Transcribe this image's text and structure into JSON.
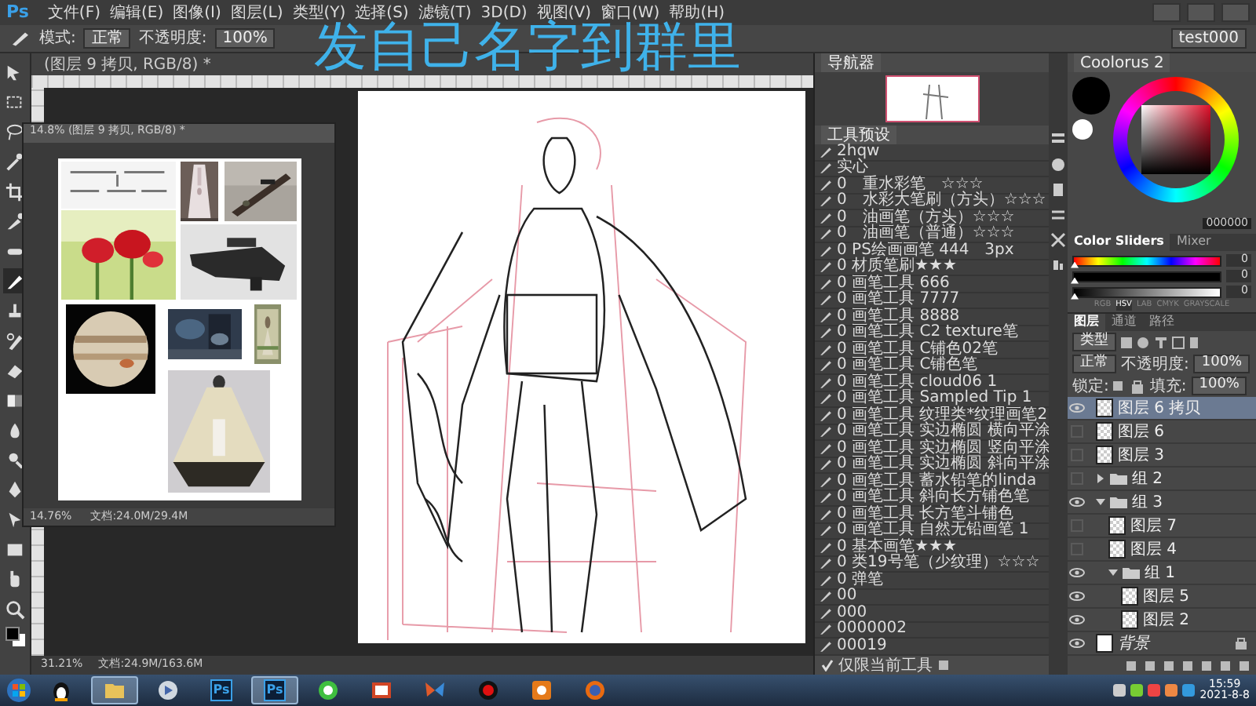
{
  "app_logo": "Ps",
  "menu": [
    "文件(F)",
    "编辑(E)",
    "图像(I)",
    "图层(L)",
    "类型(Y)",
    "选择(S)",
    "滤镜(T)",
    "3D(D)",
    "视图(V)",
    "窗口(W)",
    "帮助(H)"
  ],
  "options": {
    "mode_label": "模式:",
    "mode": "正常",
    "opacity_label": "不透明度:",
    "opacity": "100%",
    "workspace": "test000"
  },
  "caption": "发自己名字到群里",
  "toolbar": [
    {
      "kind": "move",
      "selected": false
    },
    {
      "kind": "marquee",
      "selected": false
    },
    {
      "kind": "lasso",
      "selected": false
    },
    {
      "kind": "wand",
      "selected": false
    },
    {
      "kind": "crop",
      "selected": false
    },
    {
      "kind": "eyedropper",
      "selected": false
    },
    {
      "kind": "heal",
      "selected": false
    },
    {
      "kind": "brush",
      "selected": true
    },
    {
      "kind": "stamp",
      "selected": false
    },
    {
      "kind": "history",
      "selected": false
    },
    {
      "kind": "eraser",
      "selected": false
    },
    {
      "kind": "gradient",
      "selected": false
    },
    {
      "kind": "blur",
      "selected": false
    },
    {
      "kind": "dodge",
      "selected": false
    },
    {
      "kind": "pen",
      "selected": false
    },
    {
      "kind": "path",
      "selected": false
    },
    {
      "kind": "shape",
      "selected": false
    },
    {
      "kind": "hand",
      "selected": false
    },
    {
      "kind": "zoom",
      "selected": false
    }
  ],
  "document": {
    "tab": "(图层 9 拷贝, RGB/8) *",
    "zoom": "31.21%",
    "info": "文档:24.9M/163.6M"
  },
  "reference_window": {
    "title": "14.8% (图层 9 拷贝, RGB/8) *",
    "zoom": "14.76%",
    "info": "文档:24.0M/29.4M"
  },
  "navigator": {
    "title": "导航器"
  },
  "tool_presets": {
    "title": "工具预设",
    "items": [
      "2hqw",
      "实心",
      "0　重水彩笔　☆☆☆",
      "0　水彩大笔刷（方头）☆☆☆",
      "0　油画笔（方头）☆☆☆",
      "0　油画笔（普通）☆☆☆",
      "0 PS绘画画笔 444　3px",
      "0 材质笔刷★★★",
      "0 画笔工具 666",
      "0 画笔工具 7777",
      "0 画笔工具 8888",
      "0 画笔工具 C2 texture笔",
      "0 画笔工具 C铺色02笔",
      "0 画笔工具 C铺色笔",
      "0 画笔工具 cloud06 1",
      "0 画笔工具 Sampled Tip 1",
      "0 画笔工具 纹理类*纹理画笔2",
      "0 画笔工具 实边椭圆 横向平涂",
      "0 画笔工具 实边椭圆 竖向平涂",
      "0 画笔工具 实边椭圆 斜向平涂",
      "0 画笔工具 蓄水铅笔的linda",
      "0 画笔工具 斜向长方铺色笔",
      "0 画笔工具 长方笔斗铺色",
      "0 画笔工具 自然无铅画笔 1",
      "0 基本画笔★★★",
      "0 类19号笔（少纹理）☆☆☆",
      "0 弹笔",
      "00",
      "000",
      "0000002",
      "00019"
    ],
    "footer": {
      "label": "仅限当前工具",
      "checked": true
    }
  },
  "coolorus": {
    "title": "Coolorus 2",
    "hex": "000000"
  },
  "color_sliders": {
    "tabs": [
      {
        "label": "Color Sliders",
        "selected": true
      },
      {
        "label": "Mixer",
        "selected": false
      }
    ],
    "sliders": [
      {
        "value": "0",
        "level": 0
      },
      {
        "value": "0",
        "level": 0
      },
      {
        "value": "0",
        "level": 0
      }
    ],
    "modes": [
      {
        "label": "RGB",
        "selected": false
      },
      {
        "label": "HSV",
        "selected": true
      },
      {
        "label": "LAB",
        "selected": false
      },
      {
        "label": "CMYK",
        "selected": false
      },
      {
        "label": "GRAYSCALE",
        "selected": false
      }
    ]
  },
  "layers": {
    "tabs": [
      {
        "label": "图层",
        "selected": true
      },
      {
        "label": "通道",
        "selected": false
      },
      {
        "label": "路径",
        "selected": false
      }
    ],
    "filter": "类型",
    "blend": "正常",
    "opacity_label": "不透明度:",
    "opacity": "100%",
    "lock_label": "锁定:",
    "fill_label": "填充:",
    "fill": "100%",
    "items": [
      {
        "name": "图层 6 拷贝",
        "kind": "layer",
        "visible": true,
        "selected": true
      },
      {
        "name": "图层 6",
        "kind": "layer",
        "visible": false,
        "selected": false
      },
      {
        "name": "图层 3",
        "kind": "layer",
        "visible": false,
        "selected": false
      },
      {
        "name": "组 2",
        "kind": "group",
        "visible": false,
        "selected": false,
        "expanded": false
      },
      {
        "name": "组 3",
        "kind": "group",
        "visible": true,
        "selected": false,
        "expanded": true,
        "children": [
          {
            "name": "图层 7",
            "kind": "layer",
            "visible": false,
            "selected": false
          },
          {
            "name": "图层 4",
            "kind": "layer",
            "visible": false,
            "selected": false
          },
          {
            "name": "组 1",
            "kind": "group",
            "visible": true,
            "selected": false,
            "expanded": true,
            "children": [
              {
                "name": "图层 5",
                "kind": "layer",
                "visible": true,
                "selected": false
              },
              {
                "name": "图层 2",
                "kind": "layer",
                "visible": true,
                "selected": false
              }
            ]
          }
        ]
      },
      {
        "name": "背景",
        "kind": "background",
        "visible": true,
        "selected": false,
        "locked": true
      }
    ]
  },
  "taskbar": {
    "apps": [
      {
        "kind": "penguin",
        "selected": false
      },
      {
        "kind": "folder",
        "selected": true
      },
      {
        "kind": "media",
        "selected": false
      },
      {
        "kind": "ps",
        "label": "Ps",
        "selected": false
      },
      {
        "kind": "ps",
        "label": "Ps",
        "selected": true
      },
      {
        "kind": "chat",
        "selected": false
      },
      {
        "kind": "slides",
        "selected": false
      },
      {
        "kind": "butterfly",
        "selected": false
      },
      {
        "kind": "record",
        "selected": false
      },
      {
        "kind": "game",
        "selected": false
      },
      {
        "kind": "browser",
        "selected": false
      }
    ],
    "time": "15:59",
    "date": "2021-8-8"
  }
}
